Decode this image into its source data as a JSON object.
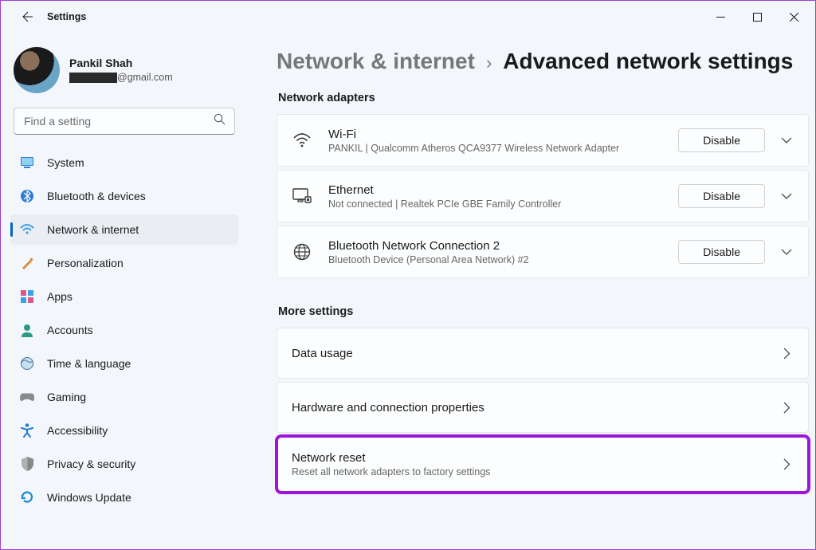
{
  "window": {
    "title": "Settings"
  },
  "profile": {
    "name": "Pankil Shah",
    "email_suffix": "@gmail.com"
  },
  "search": {
    "placeholder": "Find a setting"
  },
  "sidebar": {
    "items": [
      {
        "label": "System"
      },
      {
        "label": "Bluetooth & devices"
      },
      {
        "label": "Network & internet"
      },
      {
        "label": "Personalization"
      },
      {
        "label": "Apps"
      },
      {
        "label": "Accounts"
      },
      {
        "label": "Time & language"
      },
      {
        "label": "Gaming"
      },
      {
        "label": "Accessibility"
      },
      {
        "label": "Privacy & security"
      },
      {
        "label": "Windows Update"
      }
    ]
  },
  "breadcrumb": {
    "parent": "Network & internet",
    "current": "Advanced network settings"
  },
  "sections": {
    "adapters_header": "Network adapters",
    "more_header": "More settings"
  },
  "adapters": [
    {
      "title": "Wi-Fi",
      "subtitle": "PANKIL | Qualcomm Atheros QCA9377 Wireless Network Adapter",
      "action": "Disable"
    },
    {
      "title": "Ethernet",
      "subtitle": "Not connected | Realtek PCIe GBE Family Controller",
      "action": "Disable"
    },
    {
      "title": "Bluetooth Network Connection 2",
      "subtitle": "Bluetooth Device (Personal Area Network) #2",
      "action": "Disable"
    }
  ],
  "more_settings": [
    {
      "title": "Data usage"
    },
    {
      "title": "Hardware and connection properties"
    },
    {
      "title": "Network reset",
      "subtitle": "Reset all network adapters to factory settings"
    }
  ]
}
